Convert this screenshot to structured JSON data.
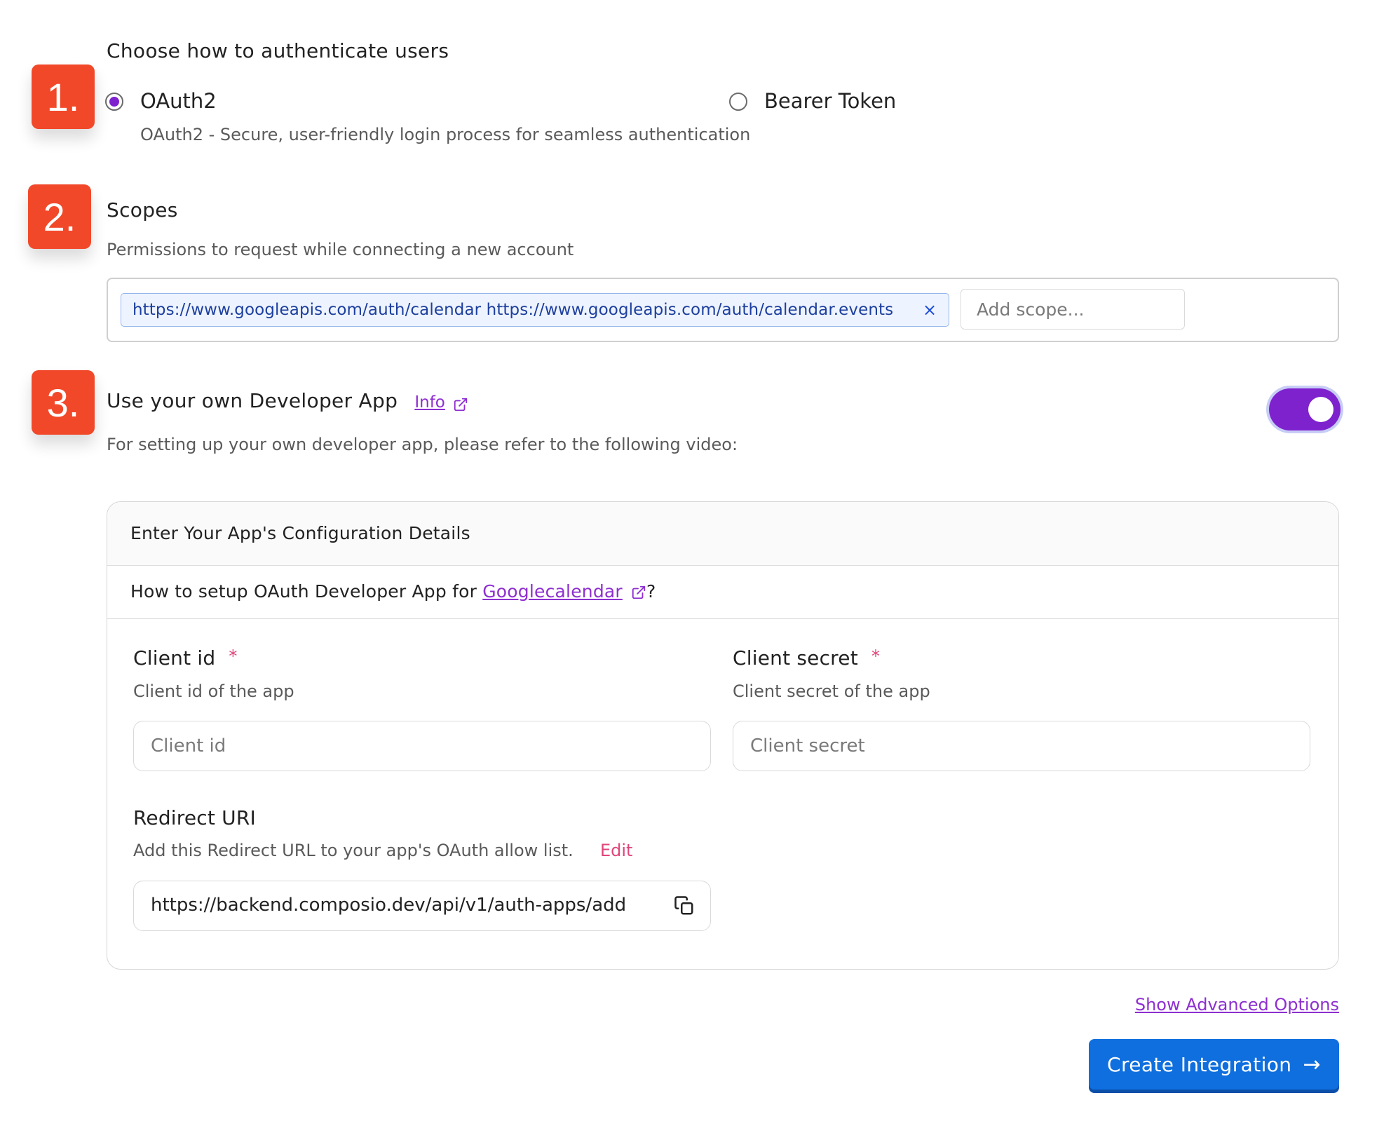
{
  "steps": [
    "1.",
    "2.",
    "3."
  ],
  "auth": {
    "title": "Choose how to authenticate users",
    "options": [
      {
        "label": "OAuth2",
        "selected": true
      },
      {
        "label": "Bearer Token",
        "selected": false
      }
    ],
    "description": "OAuth2 - Secure, user-friendly login process for seamless authentication"
  },
  "scopes": {
    "title": "Scopes",
    "description": "Permissions to request while connecting a new account",
    "chip": "https://www.googleapis.com/auth/calendar https://www.googleapis.com/auth/calendar.events",
    "chip_close": "×",
    "input_placeholder": "Add scope..."
  },
  "developer_app": {
    "title": "Use your own Developer App",
    "info_link": "Info",
    "description": "For setting up your own developer app, please refer to the following video:",
    "toggle_on": true
  },
  "config_panel": {
    "header": "Enter Your App's Configuration Details",
    "howto_prefix": "How to setup OAuth Developer App for ",
    "howto_link": "Googlecalendar",
    "howto_suffix": "?",
    "client_id": {
      "label": "Client id",
      "required_mark": "*",
      "description": "Client id of the app",
      "placeholder": "Client id"
    },
    "client_secret": {
      "label": "Client secret",
      "required_mark": "*",
      "description": "Client secret of the app",
      "placeholder": "Client secret"
    },
    "redirect": {
      "label": "Redirect URI",
      "description": "Add this Redirect URL to your app's OAuth allow list.",
      "edit_label": "Edit",
      "value": "https://backend.composio.dev/api/v1/auth-apps/add"
    }
  },
  "footer": {
    "advanced_link": "Show Advanced Options",
    "cta_label": "Create Integration",
    "cta_arrow": "→"
  },
  "colors": {
    "badge": "#f2482a",
    "accent_purple": "#7e22ce",
    "link_purple": "#8e2fd0",
    "cta_blue": "#0f6fde",
    "required_pink": "#e0457b"
  },
  "icons": [
    "external-link-icon",
    "close-icon",
    "copy-icon",
    "arrow-right-icon"
  ]
}
